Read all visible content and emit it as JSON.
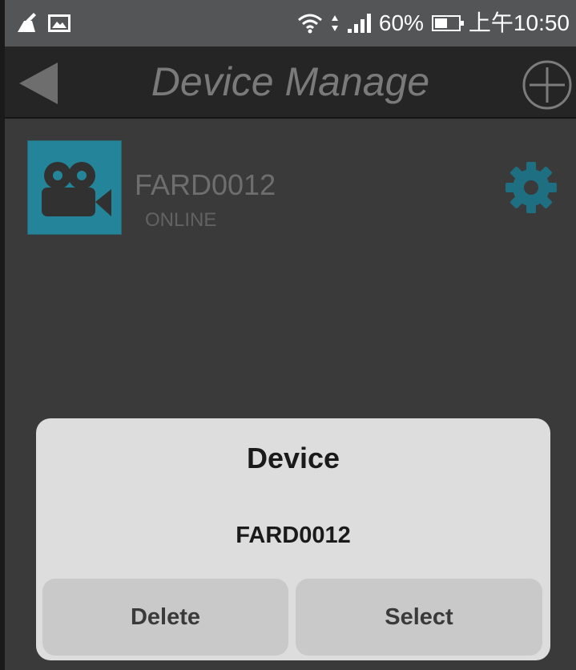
{
  "status_bar": {
    "battery_percent": "60%",
    "battery_level": 0.6,
    "time": "上午10:50",
    "icons": [
      "cleaner-broom-icon",
      "image-notification-icon",
      "wifi-icon",
      "data-arrows-icon",
      "signal-icon",
      "battery-icon"
    ]
  },
  "header": {
    "title": "Device Manage",
    "back_icon": "back-arrow-icon",
    "add_icon": "add-circle-icon"
  },
  "device": {
    "name": "FARD0012",
    "status": "ONLINE",
    "thumbnail_icon": "video-camera-icon",
    "settings_icon": "gear-icon",
    "accent_color": "#23849a"
  },
  "dialog": {
    "title": "Device",
    "message": "FARD0012",
    "buttons": {
      "delete": "Delete",
      "select": "Select"
    }
  }
}
